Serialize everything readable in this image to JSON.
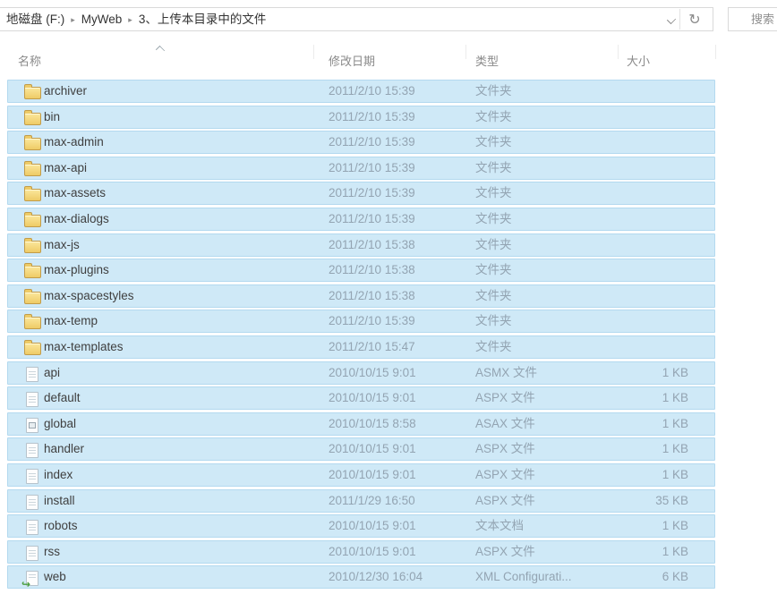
{
  "address_bar": {
    "breadcrumb": [
      "地磁盘 (F:)",
      "MyWeb",
      "3、上传本目录中的文件"
    ],
    "separator": "▸"
  },
  "toolbar_icons": {
    "refresh": "↻"
  },
  "search": {
    "label": "搜索"
  },
  "list": {
    "columns": [
      {
        "label": "名称"
      },
      {
        "label": "修改日期"
      },
      {
        "label": "类型"
      },
      {
        "label": "大小"
      }
    ],
    "sort": {
      "column": "名称",
      "direction": "ascending"
    },
    "files": [
      {
        "name": "archiver",
        "date": "2011/2/10 15:39",
        "type": "文件夹",
        "size": "",
        "icon": "folder-icon"
      },
      {
        "name": "bin",
        "date": "2011/2/10 15:39",
        "type": "文件夹",
        "size": "",
        "icon": "folder-icon"
      },
      {
        "name": "max-admin",
        "date": "2011/2/10 15:39",
        "type": "文件夹",
        "size": "",
        "icon": "folder-icon"
      },
      {
        "name": "max-api",
        "date": "2011/2/10 15:39",
        "type": "文件夹",
        "size": "",
        "icon": "folder-icon"
      },
      {
        "name": "max-assets",
        "date": "2011/2/10 15:39",
        "type": "文件夹",
        "size": "",
        "icon": "folder-icon"
      },
      {
        "name": "max-dialogs",
        "date": "2011/2/10 15:39",
        "type": "文件夹",
        "size": "",
        "icon": "folder-icon"
      },
      {
        "name": "max-js",
        "date": "2011/2/10 15:38",
        "type": "文件夹",
        "size": "",
        "icon": "folder-icon"
      },
      {
        "name": "max-plugins",
        "date": "2011/2/10 15:38",
        "type": "文件夹",
        "size": "",
        "icon": "folder-icon"
      },
      {
        "name": "max-spacestyles",
        "date": "2011/2/10 15:38",
        "type": "文件夹",
        "size": "",
        "icon": "folder-icon"
      },
      {
        "name": "max-temp",
        "date": "2011/2/10 15:39",
        "type": "文件夹",
        "size": "",
        "icon": "folder-icon"
      },
      {
        "name": "max-templates",
        "date": "2011/2/10 15:47",
        "type": "文件夹",
        "size": "",
        "icon": "folder-icon"
      },
      {
        "name": "api",
        "date": "2010/10/15 9:01",
        "type": "ASMX 文件",
        "size": "1 KB",
        "icon": "document-icon"
      },
      {
        "name": "default",
        "date": "2010/10/15 9:01",
        "type": "ASPX 文件",
        "size": "1 KB",
        "icon": "document-icon"
      },
      {
        "name": "global",
        "date": "2010/10/15 8:58",
        "type": "ASAX 文件",
        "size": "1 KB",
        "icon": "asax-document-icon"
      },
      {
        "name": "handler",
        "date": "2010/10/15 9:01",
        "type": "ASPX 文件",
        "size": "1 KB",
        "icon": "document-icon"
      },
      {
        "name": "index",
        "date": "2010/10/15 9:01",
        "type": "ASPX 文件",
        "size": "1 KB",
        "icon": "document-icon"
      },
      {
        "name": "install",
        "date": "2011/1/29 16:50",
        "type": "ASPX 文件",
        "size": "35 KB",
        "icon": "document-icon"
      },
      {
        "name": "robots",
        "date": "2010/10/15 9:01",
        "type": "文本文档",
        "size": "1 KB",
        "icon": "document-icon"
      },
      {
        "name": "rss",
        "date": "2010/10/15 9:01",
        "type": "ASPX 文件",
        "size": "1 KB",
        "icon": "document-icon"
      },
      {
        "name": "web",
        "date": "2010/12/30 16:04",
        "type": "XML Configurati...",
        "size": "6 KB",
        "icon": "xml-config-icon"
      }
    ]
  },
  "colors": {
    "selection_bg": "#cfe9f7",
    "selection_border": "#b3d9ef",
    "folder_yellow": "#eecb66",
    "meta_text": "#93a4b2",
    "xml_arrow_green": "#4a9e3f"
  }
}
